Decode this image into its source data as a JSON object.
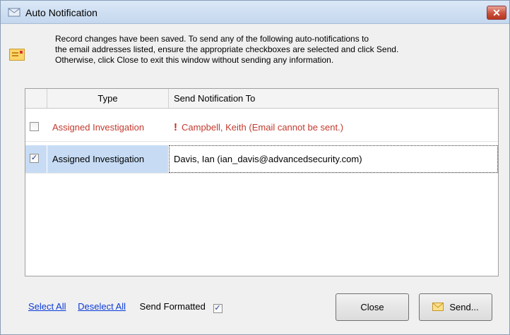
{
  "window": {
    "title": "Auto Notification",
    "close_glyph": "✕",
    "title_icon": "mail-notification-icon"
  },
  "message": {
    "icon": "envelope-icon",
    "lines": [
      "Record changes have been saved. To send any of the following auto-notifications to",
      "the email addresses listed, ensure the appropriate checkboxes are selected and click Send.",
      "Otherwise, click Close to exit this window without sending any information."
    ]
  },
  "grid": {
    "columns": [
      "Type",
      "Send Notification To"
    ],
    "rows": [
      {
        "checked": false,
        "type": "Assigned Investigation",
        "recipient": "Campbell, Keith (Email cannot be sent.)",
        "error": true,
        "icon": "exclamation-icon"
      },
      {
        "checked": true,
        "type": "Assigned Investigation",
        "recipient": "Davis, Ian (ian_davis@advancedsecurity.com)",
        "error": false,
        "selected": true
      }
    ]
  },
  "footer": {
    "select_all": "Select All",
    "deselect_all": "Deselect All",
    "send_formatted_label": "Send Formatted",
    "send_formatted_checked": true,
    "close_label": "Close",
    "send_label": "Send...",
    "send_icon": "envelope-icon"
  },
  "colors": {
    "error_text": "#c23a2e",
    "link": "#0b3bd7",
    "selection": "#c7dcf4"
  }
}
